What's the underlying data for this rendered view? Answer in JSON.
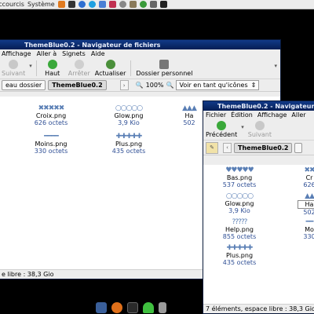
{
  "desktop": {
    "top_panel": {
      "menus": [
        "Raccourcis",
        "Système"
      ],
      "launcher_icons": [
        "home-icon",
        "terminal-icon",
        "web-icon",
        "skype-icon",
        "help-icon",
        "mail-icon",
        "settings-icon",
        "gimp-icon",
        "chat-icon",
        "network-icon",
        "display-icon"
      ]
    },
    "dock": {
      "icons": [
        "file-manager-icon",
        "firefox-icon",
        "terminal-icon",
        "wifi-icon",
        "trash-icon"
      ]
    }
  },
  "window_back": {
    "title": "ThemeBlue0.2 - Navigateur de fichiers",
    "menu": [
      "Affichage",
      "Aller à",
      "Signets",
      "Aide"
    ],
    "toolbar": [
      {
        "label": "Suivant",
        "disabled": true,
        "icon": "forward-arrow-icon"
      },
      {
        "label": "Haut",
        "disabled": false,
        "icon": "up-arrow-icon"
      },
      {
        "label": "Arrêter",
        "disabled": true,
        "icon": "stop-icon"
      },
      {
        "label": "Actualiser",
        "disabled": false,
        "icon": "refresh-icon"
      },
      {
        "label": "Dossier personnel",
        "disabled": false,
        "icon": "home-icon"
      }
    ],
    "location": {
      "prev_segment": "eau dossier",
      "current_segment": "ThemeBlue0.2",
      "zoom": "100%",
      "view_mode": "Voir en tant qu'icônes"
    },
    "files": [
      {
        "glyphs": "✖✖✖✖✖",
        "name": "Croix.png",
        "size": "626 octets"
      },
      {
        "glyphs": "○○○○○",
        "name": "Glow.png",
        "size": "3,9 Kio"
      },
      {
        "glyphs": "▲▲▲",
        "name": "Ha",
        "size": "502"
      },
      {
        "glyphs": "━━━━",
        "name": "Moins.png",
        "size": "330 octets"
      },
      {
        "glyphs": "✚✚✚✚✚",
        "name": "Plus.png",
        "size": "435 octets"
      }
    ],
    "status": "e libre : 38,3 Gio"
  },
  "window_front": {
    "title": "ThemeBlue0.2 - Navigateur",
    "menu": [
      "Fichier",
      "Édition",
      "Affichage",
      "Aller"
    ],
    "toolbar": [
      {
        "label": "Précédent",
        "disabled": false,
        "icon": "back-arrow-icon"
      },
      {
        "label": "Suivant",
        "disabled": true,
        "icon": "forward-arrow-icon"
      }
    ],
    "location": {
      "current_segment": "ThemeBlue0.2"
    },
    "files": [
      {
        "glyphs": "♥♥♥♥♥",
        "name": "Bas.png",
        "size": "537 octets"
      },
      {
        "glyphs": "✖✖",
        "name": "Cr",
        "size": "626"
      },
      {
        "glyphs": "○○○○○",
        "name": "Glow.png",
        "size": "3,9 Kio"
      },
      {
        "glyphs": "▲▲",
        "name": "Ha",
        "size": "502"
      },
      {
        "glyphs": "?????",
        "name": "Help.png",
        "size": "855 octets"
      },
      {
        "glyphs": "━━",
        "name": "Mo",
        "size": "330"
      },
      {
        "glyphs": "✚✚✚✚✚",
        "name": "Plus.png",
        "size": "435 octets"
      }
    ],
    "status": "7 éléments, espace libre : 38,3 Gio"
  }
}
